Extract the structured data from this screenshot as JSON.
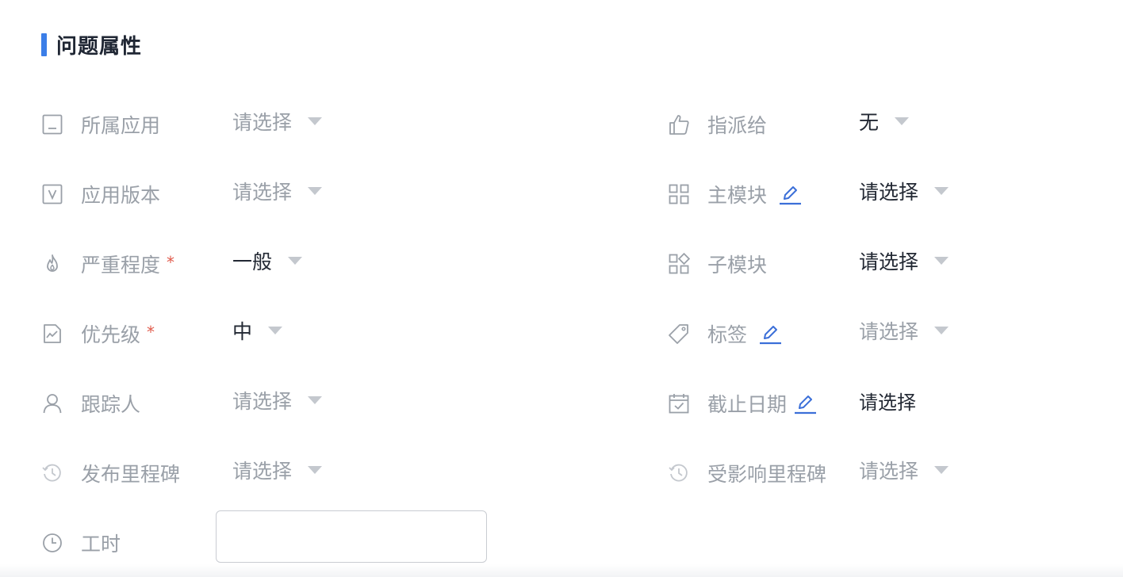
{
  "section": {
    "title": "问题属性",
    "accent_color": "#3b7ee8"
  },
  "left_fields": [
    {
      "label": "所属应用",
      "icon": "app-icon",
      "value": "请选择",
      "placeholder": true,
      "required": false
    },
    {
      "label": "应用版本",
      "icon": "version-icon",
      "value": "请选择",
      "placeholder": true,
      "required": false
    },
    {
      "label": "严重程度",
      "icon": "flame-icon",
      "value": "一般",
      "placeholder": false,
      "required": true
    },
    {
      "label": "优先级",
      "icon": "priority-icon",
      "value": "中",
      "placeholder": false,
      "required": true
    },
    {
      "label": "跟踪人",
      "icon": "user-icon",
      "value": "请选择",
      "placeholder": true,
      "required": false
    },
    {
      "label": "发布里程碑",
      "icon": "milestone-icon",
      "value": "请选择",
      "placeholder": true,
      "required": false
    },
    {
      "label": "工时",
      "icon": "clock-icon",
      "value": "",
      "input_placeholder": ""
    }
  ],
  "right_fields": [
    {
      "label": "指派给",
      "icon": "hand-point-icon",
      "value": "无",
      "placeholder": false,
      "editable": false
    },
    {
      "label": "主模块",
      "icon": "grid-icon",
      "value": "请选择",
      "placeholder": false,
      "editable": true
    },
    {
      "label": "子模块",
      "icon": "sub-grid-icon",
      "value": "请选择",
      "placeholder": false,
      "editable": false
    },
    {
      "label": "标签",
      "icon": "tag-icon",
      "value": "请选择",
      "placeholder": true,
      "editable": true
    },
    {
      "label": "截止日期",
      "icon": "calendar-icon",
      "value": "请选择",
      "placeholder": false,
      "editable": true
    },
    {
      "label": "受影响里程碑",
      "icon": "milestone-icon",
      "value": "请选择",
      "placeholder": true,
      "editable": false
    }
  ],
  "required_mark": "*",
  "colors": {
    "label": "#9aa0a8",
    "value": "#222833",
    "edit_icon": "#3b6fd8",
    "required": "#e05b4c"
  }
}
